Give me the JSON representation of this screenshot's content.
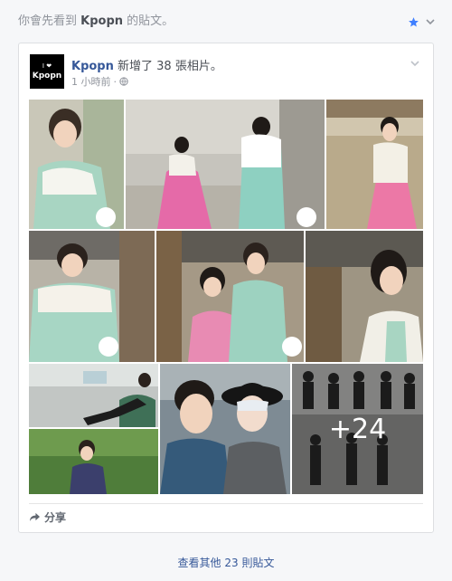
{
  "notice": {
    "prefix": "你會先看到",
    "page_name": "Kpopn",
    "suffix": "的貼文。"
  },
  "post": {
    "avatar": {
      "heart_row": "I ❤",
      "logo": "Kpopn"
    },
    "page_name": "Kpopn",
    "action": "新增了 38 張相片。",
    "time": "1 小時前",
    "audience_separator": "·",
    "more_photos_count": "+24",
    "share_label": "分享"
  },
  "footer": {
    "see_more_prefix": "查看其他",
    "see_more_count": "23",
    "see_more_suffix": "則貼文"
  },
  "colors": {
    "link_blue": "#365899",
    "star_blue": "#4080ff",
    "muted_gray": "#90949c"
  },
  "icons": [
    "star-icon",
    "chevron-down-icon",
    "globe-icon",
    "share-arrow-icon"
  ]
}
